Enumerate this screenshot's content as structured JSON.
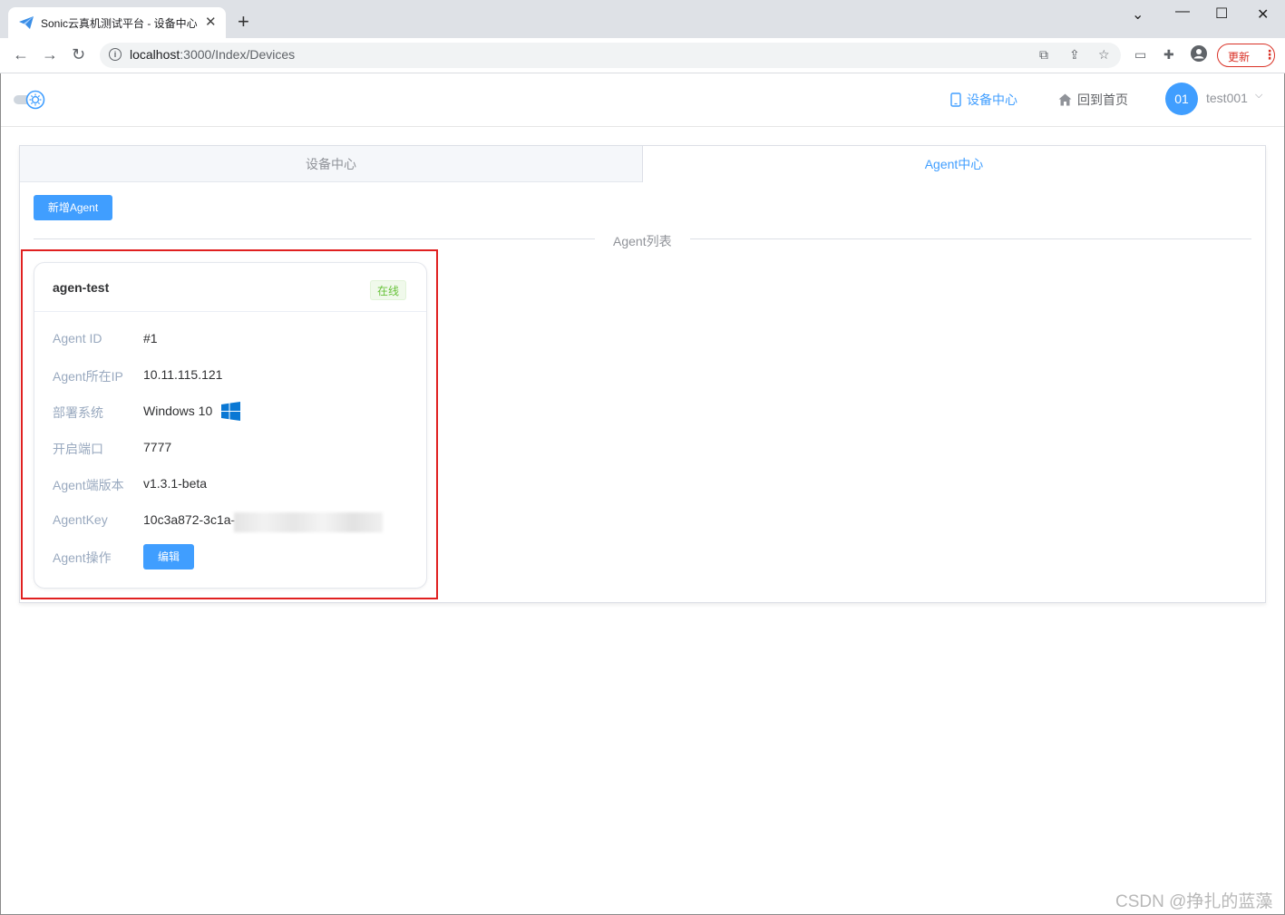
{
  "browser": {
    "tab_title": "Sonic云真机测试平台 - 设备中心",
    "url_host": "localhost",
    "url_rest": ":3000/Index/Devices",
    "update_label": "更新"
  },
  "header": {
    "menu": [
      {
        "label": "设备中心",
        "icon": "device-icon",
        "active": true
      },
      {
        "label": "回到首页",
        "icon": "home-icon",
        "active": false
      }
    ],
    "avatar_text": "01",
    "username": "test001"
  },
  "tabs": [
    {
      "label": "设备中心",
      "active": false
    },
    {
      "label": "Agent中心",
      "active": true
    }
  ],
  "add_agent_label": "新增Agent",
  "list_title": "Agent列表",
  "agent": {
    "name": "agen-test",
    "status": "在线",
    "fields": [
      {
        "label": "Agent ID",
        "value": "#1"
      },
      {
        "label": "Agent所在IP",
        "value": "10.11.115.121"
      },
      {
        "label": "部署系统",
        "value": "Windows 10",
        "icon": "windows-icon"
      },
      {
        "label": "开启端口",
        "value": "7777"
      },
      {
        "label": "Agent端版本",
        "value": "v1.3.1-beta"
      },
      {
        "label": "AgentKey",
        "value": "10c3a872-3c1a-"
      },
      {
        "label": "Agent操作",
        "value": ""
      }
    ],
    "edit_label": "编辑"
  },
  "colors": {
    "primary": "#409eff",
    "success": "#67c23a",
    "highlight": "#e02020"
  },
  "watermark": "CSDN @挣扎的蓝藻"
}
